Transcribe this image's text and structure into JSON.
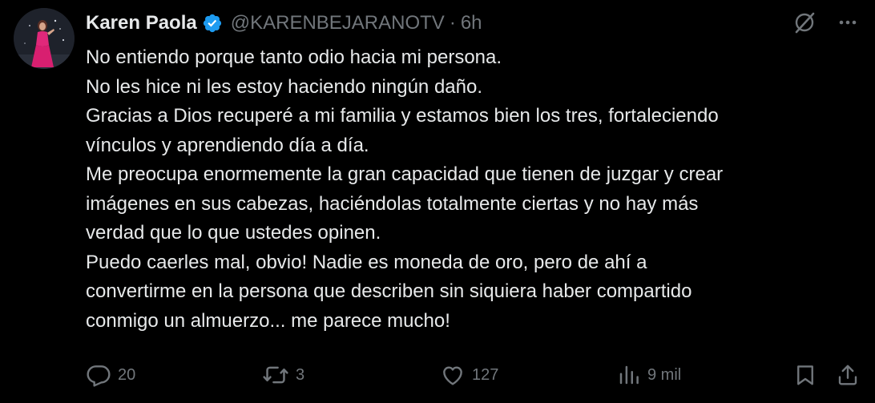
{
  "author": {
    "name": "Karen Paola",
    "handle": "@KARENBEJARANOTV",
    "separator": "·",
    "time": "6h",
    "verified": true
  },
  "tweet": {
    "lines": [
      "No entiendo porque tanto odio hacia mi persona.",
      "No les hice ni les estoy haciendo ningún daño.",
      "Gracias a Dios recuperé a mi familia y estamos bien los tres, fortaleciendo",
      "vínculos y aprendiendo día a día.",
      "Me preocupa enormemente la gran capacidad que tienen de juzgar y crear",
      "imágenes en sus cabezas, haciéndolas totalmente ciertas y no hay más",
      "verdad que lo que ustedes opinen.",
      "Puedo caerles mal, obvio! Nadie es moneda de oro, pero de ahí a",
      "convertirme en la persona que describen sin siquiera haber compartido",
      "conmigo un almuerzo... me parece mucho!"
    ]
  },
  "actions": {
    "replies": "20",
    "reposts": "3",
    "likes": "127",
    "views": "9 mil"
  },
  "icons": {
    "verified": "verified-badge-icon",
    "grok": "grok-icon",
    "more": "more-icon",
    "reply": "reply-icon",
    "repost": "repost-icon",
    "like": "heart-icon",
    "views": "views-icon",
    "bookmark": "bookmark-icon",
    "share": "share-icon"
  },
  "colors": {
    "background": "#000000",
    "text": "#e7e9ea",
    "muted": "#71767b",
    "verified": "#1d9bf0"
  }
}
